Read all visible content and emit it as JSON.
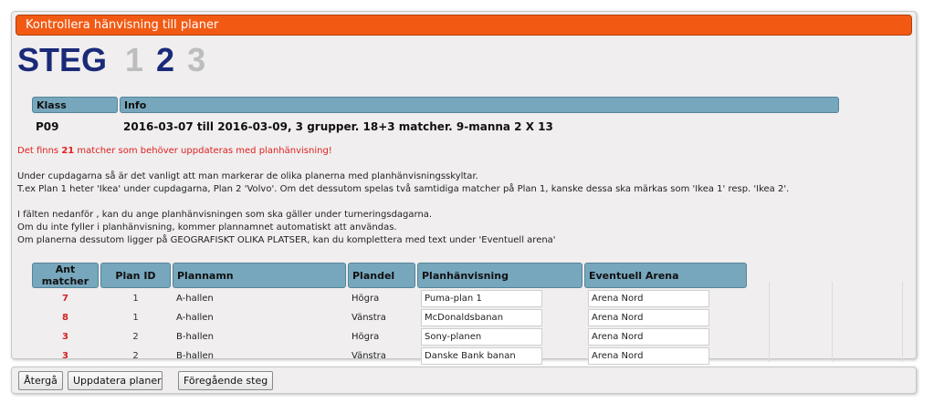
{
  "panel": {
    "title": "Kontrollera hänvisning till planer",
    "steps": {
      "label": "STEG",
      "step1": "1",
      "step2": "2",
      "step3": "3",
      "current": 2
    }
  },
  "info_table": {
    "headers": {
      "klass": "Klass",
      "info": "Info"
    },
    "row": {
      "klass": "P09",
      "info": "2016-03-07 till 2016-03-09, 3 grupper. 18+3 matcher.   9-manna 2 X 13"
    }
  },
  "notice": {
    "prefix": "Det finns ",
    "count": "21",
    "suffix": " matcher som behöver uppdateras med planhänvisning!"
  },
  "description": [
    "Under cupdagarna så är det vanligt att man markerar de olika planerna med planhänvisningsskyltar.",
    "T.ex Plan 1 heter 'Ikea' under cupdagarna, Plan 2 'Volvo'. Om det dessutom spelas två samtidiga matcher på Plan 1, kanske dessa ska märkas som 'Ikea 1' resp. 'Ikea 2'.",
    "I fälten nedanför , kan du ange planhänvisningen som ska gäller under turneringsdagarna.",
    "Om du inte fyller i planhänvisning, kommer plannamnet automatiskt att användas.",
    "Om planerna dessutom ligger på GEOGRAFISKT OLIKA PLATSER, kan du komplettera med text under 'Eventuell arena'"
  ],
  "plans_table": {
    "headers": {
      "ant": "Ant matcher",
      "plan_id": "Plan ID",
      "plannamn": "Plannamn",
      "plandel": "Plandel",
      "hanvisning": "Planhänvisning",
      "arena": "Eventuell Arena"
    },
    "rows": [
      {
        "ant": "7",
        "plan_id": "1",
        "plannamn": "A-hallen",
        "plandel": "Högra",
        "hanvisning": "Puma-plan 1",
        "arena": "Arena Nord"
      },
      {
        "ant": "8",
        "plan_id": "1",
        "plannamn": "A-hallen",
        "plandel": "Vänstra",
        "hanvisning": "McDonaldsbanan",
        "arena": "Arena Nord"
      },
      {
        "ant": "3",
        "plan_id": "2",
        "plannamn": "B-hallen",
        "plandel": "Högra",
        "hanvisning": "Sony-planen",
        "arena": "Arena Nord"
      },
      {
        "ant": "3",
        "plan_id": "2",
        "plannamn": "B-hallen",
        "plandel": "Vänstra",
        "hanvisning": "Danske Bank banan",
        "arena": "Arena Nord"
      }
    ]
  },
  "footer": {
    "back": "Återgå",
    "update": "Uppdatera planer",
    "previous": "Föregående steg"
  },
  "colors": {
    "title_bar": "#f25a14",
    "header_cell": "#77a7bd",
    "step_active": "#1a2a78",
    "step_inactive": "#bdbdbd",
    "alert_text": "#e02020"
  }
}
